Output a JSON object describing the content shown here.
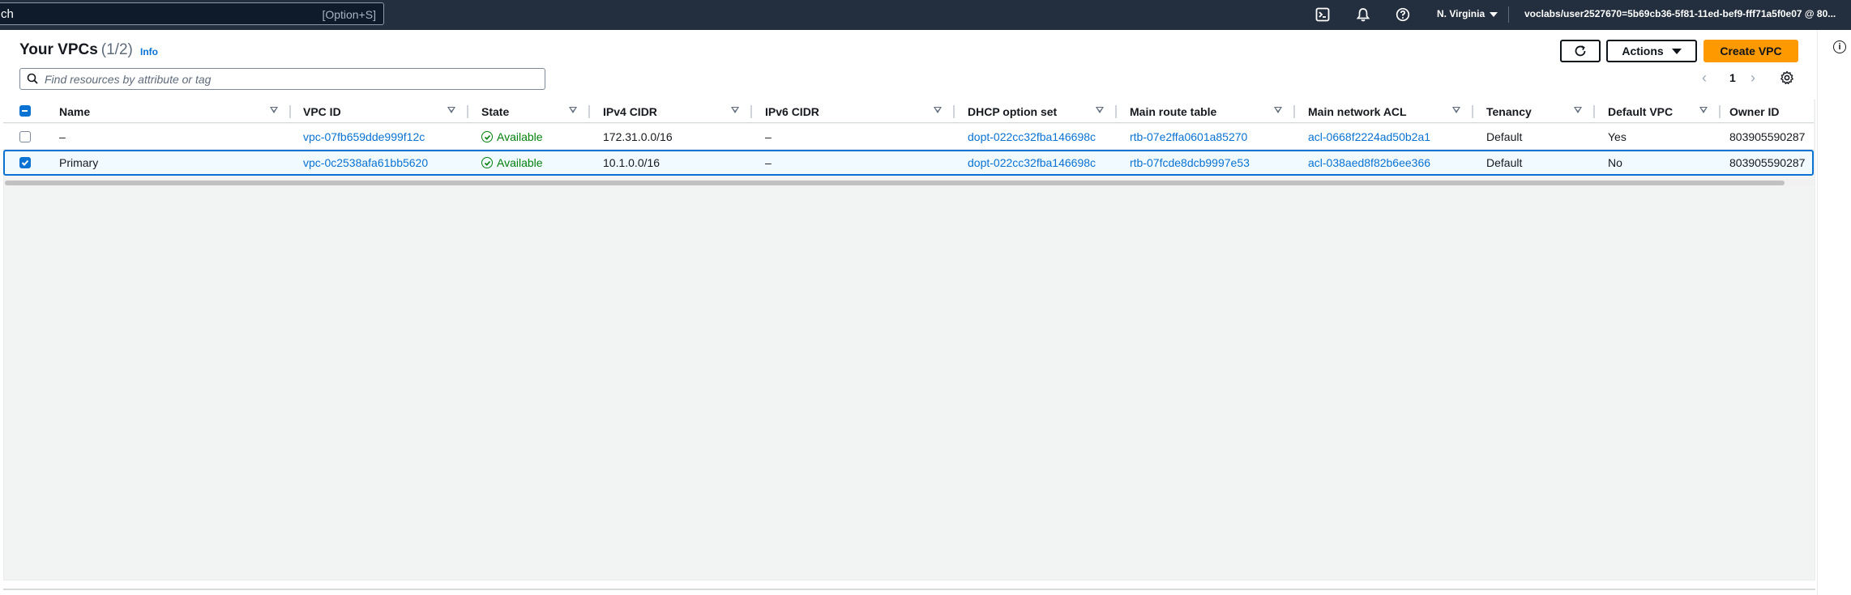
{
  "topnav": {
    "search_text": "ch",
    "search_shortcut": "[Option+S]",
    "region": "N. Virginia",
    "account": "voclabs/user2527670=5b69cb36-5f81-11ed-bef9-fff71a5f0e07 @ 80...",
    "icons": [
      "cloudshell-icon",
      "bell-icon",
      "help-icon"
    ]
  },
  "header": {
    "title": "Your VPCs",
    "count": "(1/2)",
    "info": "Info",
    "actions_label": "Actions",
    "create_label": "Create VPC"
  },
  "filter": {
    "placeholder": "Find resources by attribute or tag"
  },
  "pagination": {
    "page": "1"
  },
  "table": {
    "columns": [
      "Name",
      "VPC ID",
      "State",
      "IPv4 CIDR",
      "IPv6 CIDR",
      "DHCP option set",
      "Main route table",
      "Main network ACL",
      "Tenancy",
      "Default VPC",
      "Owner ID"
    ],
    "rows": [
      {
        "selected": false,
        "name": "–",
        "vpc_id": "vpc-07fb659dde999f12c",
        "state": "Available",
        "ipv4": "172.31.0.0/16",
        "ipv6": "–",
        "dhcp": "dopt-022cc32fba146698c",
        "route_table": "rtb-07e2ffa0601a85270",
        "acl": "acl-0668f2224ad50b2a1",
        "tenancy": "Default",
        "default_vpc": "Yes",
        "owner": "803905590287"
      },
      {
        "selected": true,
        "name": "Primary",
        "vpc_id": "vpc-0c2538afa61bb5620",
        "state": "Available",
        "ipv4": "10.1.0.0/16",
        "ipv6": "–",
        "dhcp": "dopt-022cc32fba146698c",
        "route_table": "rtb-07fcde8dcb9997e53",
        "acl": "acl-038aed8f82b6ee366",
        "tenancy": "Default",
        "default_vpc": "No",
        "owner": "803905590287"
      }
    ]
  },
  "colors": {
    "nav_bg": "#232f3e",
    "link": "#0972d3",
    "primary_button": "#ff9900",
    "success": "#037f0c"
  }
}
